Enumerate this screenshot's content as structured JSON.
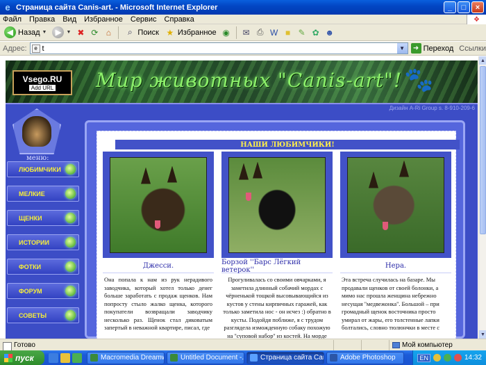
{
  "window": {
    "title": "Страница сайта Canis-art. - Microsoft Internet Explorer",
    "min_glyph": "_",
    "max_glyph": "□",
    "close_glyph": "×"
  },
  "menubar": {
    "items": [
      "Файл",
      "Правка",
      "Вид",
      "Избранное",
      "Сервис",
      "Справка"
    ]
  },
  "toolbar": {
    "back_label": "Назад",
    "search_label": "Поиск",
    "favorites_label": "Избранное"
  },
  "address": {
    "label": "Адрес:",
    "value": "t",
    "go_label": "Переход",
    "links_label": "Ссылки"
  },
  "site": {
    "counter_title": "Vsego.RU",
    "counter_sub": "Add URL",
    "title": "Мир животных \"Canis-art\"!",
    "design_credit": "Дизайн А-Ri Group s. 8-910-209-6",
    "menu_label": "меню:",
    "menu": [
      "ЛЮБИМЧИКИ",
      "МЕЛКИЕ",
      "ЩЕНКИ",
      "ИСТОРИИ",
      "ФОТКИ",
      "ФОРУМ",
      "СОВЕТЫ"
    ],
    "section_title": "НАШИ ЛЮБИМЧИКИ!",
    "pets": [
      {
        "name": "Джесси.",
        "desc": "Она попала к нам из рук нерадивого заводчика, который хотел только денег больше заработать с продаж щенков. Нам попросту стыло жалко щенка, которого покупатели возвращали заводчику несколько раз. Щенок стал диковатым запертый в неважной квартире, писал, где"
      },
      {
        "name": "Борзой ''Барс Лёгкий ветерок''",
        "desc": "Прогуливалась со своими овчарками, я заметила длинный собачий мордах с чёрненькой тощкой высовывающийся из кустов у стены кирпичных гаражей, как только заметила нос - он исчез :) обратно в кусты. Подойдя поближе, я с трудом разглядела изможденную собаку похожую на ''суповой набор'' из костей. На морде"
      },
      {
        "name": "Нера.",
        "desc": "Эта встреча случилась на базаре. Мы продавали щенков от своей болонки, а мимо нас прошла женщина небрежно несущая ''медвежонка''. Большой – при громадный щенок восточника просто умирал от жары, его толстенные лапки болтались, словно тюлюнчки в месте с"
      }
    ]
  },
  "statusbar": {
    "status": "Готово",
    "zone": "Мой компьютер"
  },
  "taskbar": {
    "start_label": "пуск",
    "tasks": [
      "Macromedia Dreamw...",
      "Untitled Document -...",
      "Страница сайта Can...",
      "Adobe Photoshop"
    ],
    "active_task": 2,
    "lang": "EN",
    "clock": "14:32"
  }
}
